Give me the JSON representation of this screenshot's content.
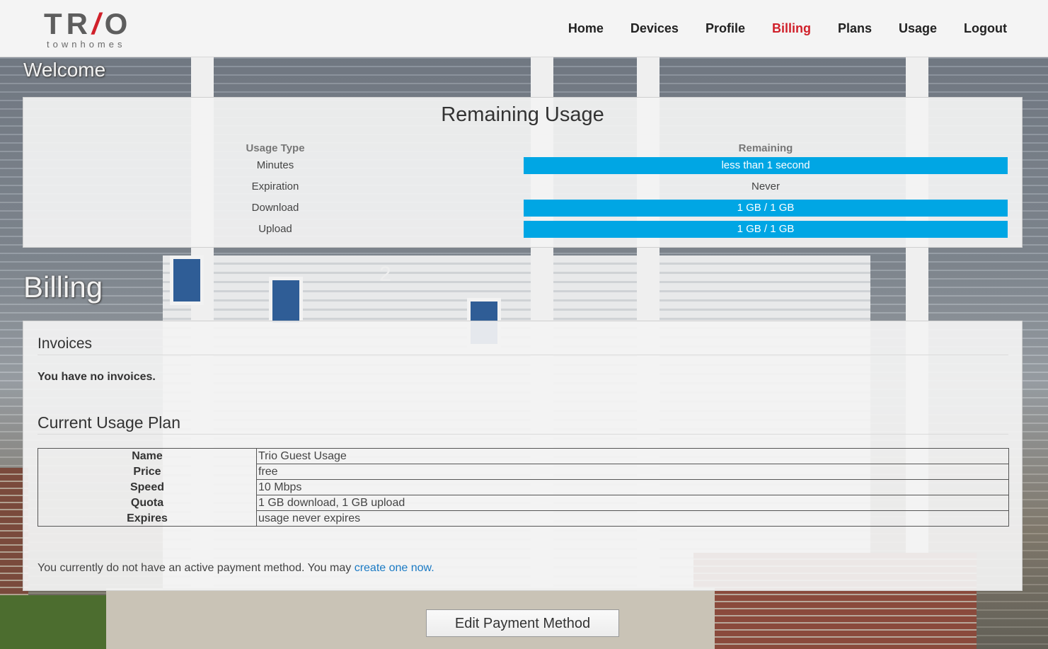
{
  "brand": {
    "name": "TRIO",
    "name_prefix": "TR",
    "name_slash": "/",
    "name_suffix": "O",
    "tagline": "townhomes"
  },
  "nav": {
    "items": [
      {
        "label": "Home",
        "active": false
      },
      {
        "label": "Devices",
        "active": false
      },
      {
        "label": "Profile",
        "active": false
      },
      {
        "label": "Billing",
        "active": true
      },
      {
        "label": "Plans",
        "active": false
      },
      {
        "label": "Usage",
        "active": false
      },
      {
        "label": "Logout",
        "active": false
      }
    ],
    "active_color": "#d0202a"
  },
  "welcome": {
    "heading": "Welcome"
  },
  "remaining_usage": {
    "title": "Remaining Usage",
    "headers": {
      "type": "Usage Type",
      "remaining": "Remaining"
    },
    "rows": [
      {
        "type": "Minutes",
        "remaining": "less than 1 second",
        "bar": true
      },
      {
        "type": "Expiration",
        "remaining": "Never",
        "bar": false
      },
      {
        "type": "Download",
        "remaining": "1 GB / 1 GB",
        "bar": true
      },
      {
        "type": "Upload",
        "remaining": "1 GB / 1 GB",
        "bar": true
      }
    ],
    "bar_color": "#00a6e4"
  },
  "billing": {
    "heading": "Billing",
    "invoices_title": "Invoices",
    "no_invoices": "You have no invoices.",
    "plan_title": "Current Usage Plan",
    "plan": [
      {
        "key": "Name",
        "value": "Trio Guest Usage"
      },
      {
        "key": "Price",
        "value": "free"
      },
      {
        "key": "Speed",
        "value": "10 Mbps"
      },
      {
        "key": "Quota",
        "value": "1 GB download, 1 GB upload"
      },
      {
        "key": "Expires",
        "value": "usage never expires"
      }
    ],
    "payment_note": "You currently do not have an active payment method. You may ",
    "payment_link": "create one now.",
    "edit_button": "Edit Payment Method"
  }
}
